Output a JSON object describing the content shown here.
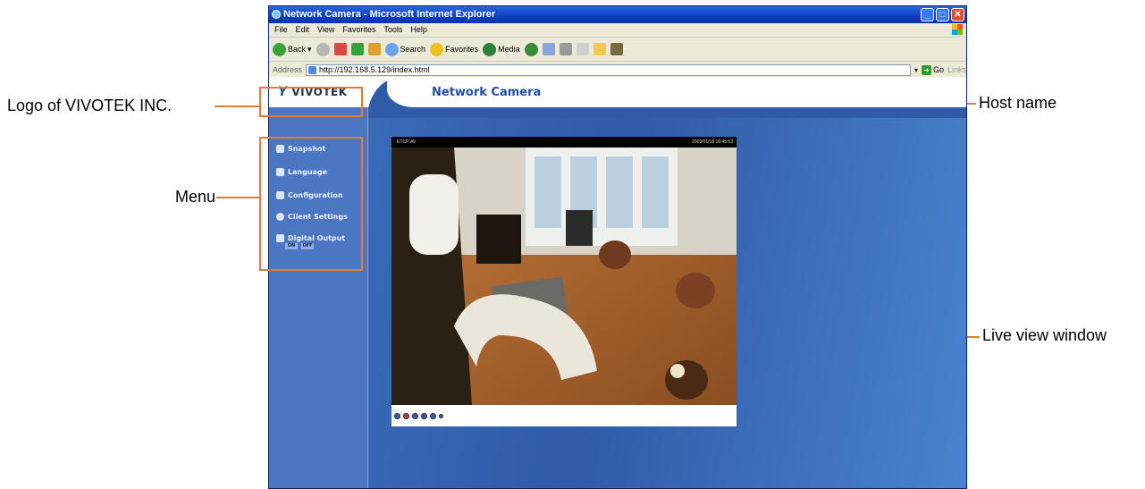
{
  "annotations": {
    "logo": "Logo of VIVOTEK INC.",
    "menu": "Menu",
    "host": "Host name",
    "live": "Live view window"
  },
  "browser": {
    "title": "Network Camera - Microsoft Internet Explorer",
    "menus": [
      "File",
      "Edit",
      "View",
      "Favorites",
      "Tools",
      "Help"
    ],
    "toolbar": {
      "back": "Back",
      "search": "Search",
      "favorites": "Favorites",
      "media": "Media"
    },
    "address_label": "Address",
    "address_value": "http://192.168.5.129/index.html",
    "go_label": "Go",
    "links_label": "Links"
  },
  "page": {
    "logo": "VIVOTEK",
    "host_name": "Network Camera",
    "menu": [
      "Snapshot",
      "Language",
      "Configuration",
      "Client Settings",
      "Digital Output"
    ],
    "digital_output_buttons": [
      "ON",
      "OFF"
    ],
    "live_view": {
      "caption_left": "ETCP-AV",
      "caption_right": "2003/01/18 18:45:53"
    }
  },
  "colors": {
    "accent": "#e07b3c",
    "page_blue": "#2f5ba8",
    "host_text": "#1f4f9f"
  }
}
